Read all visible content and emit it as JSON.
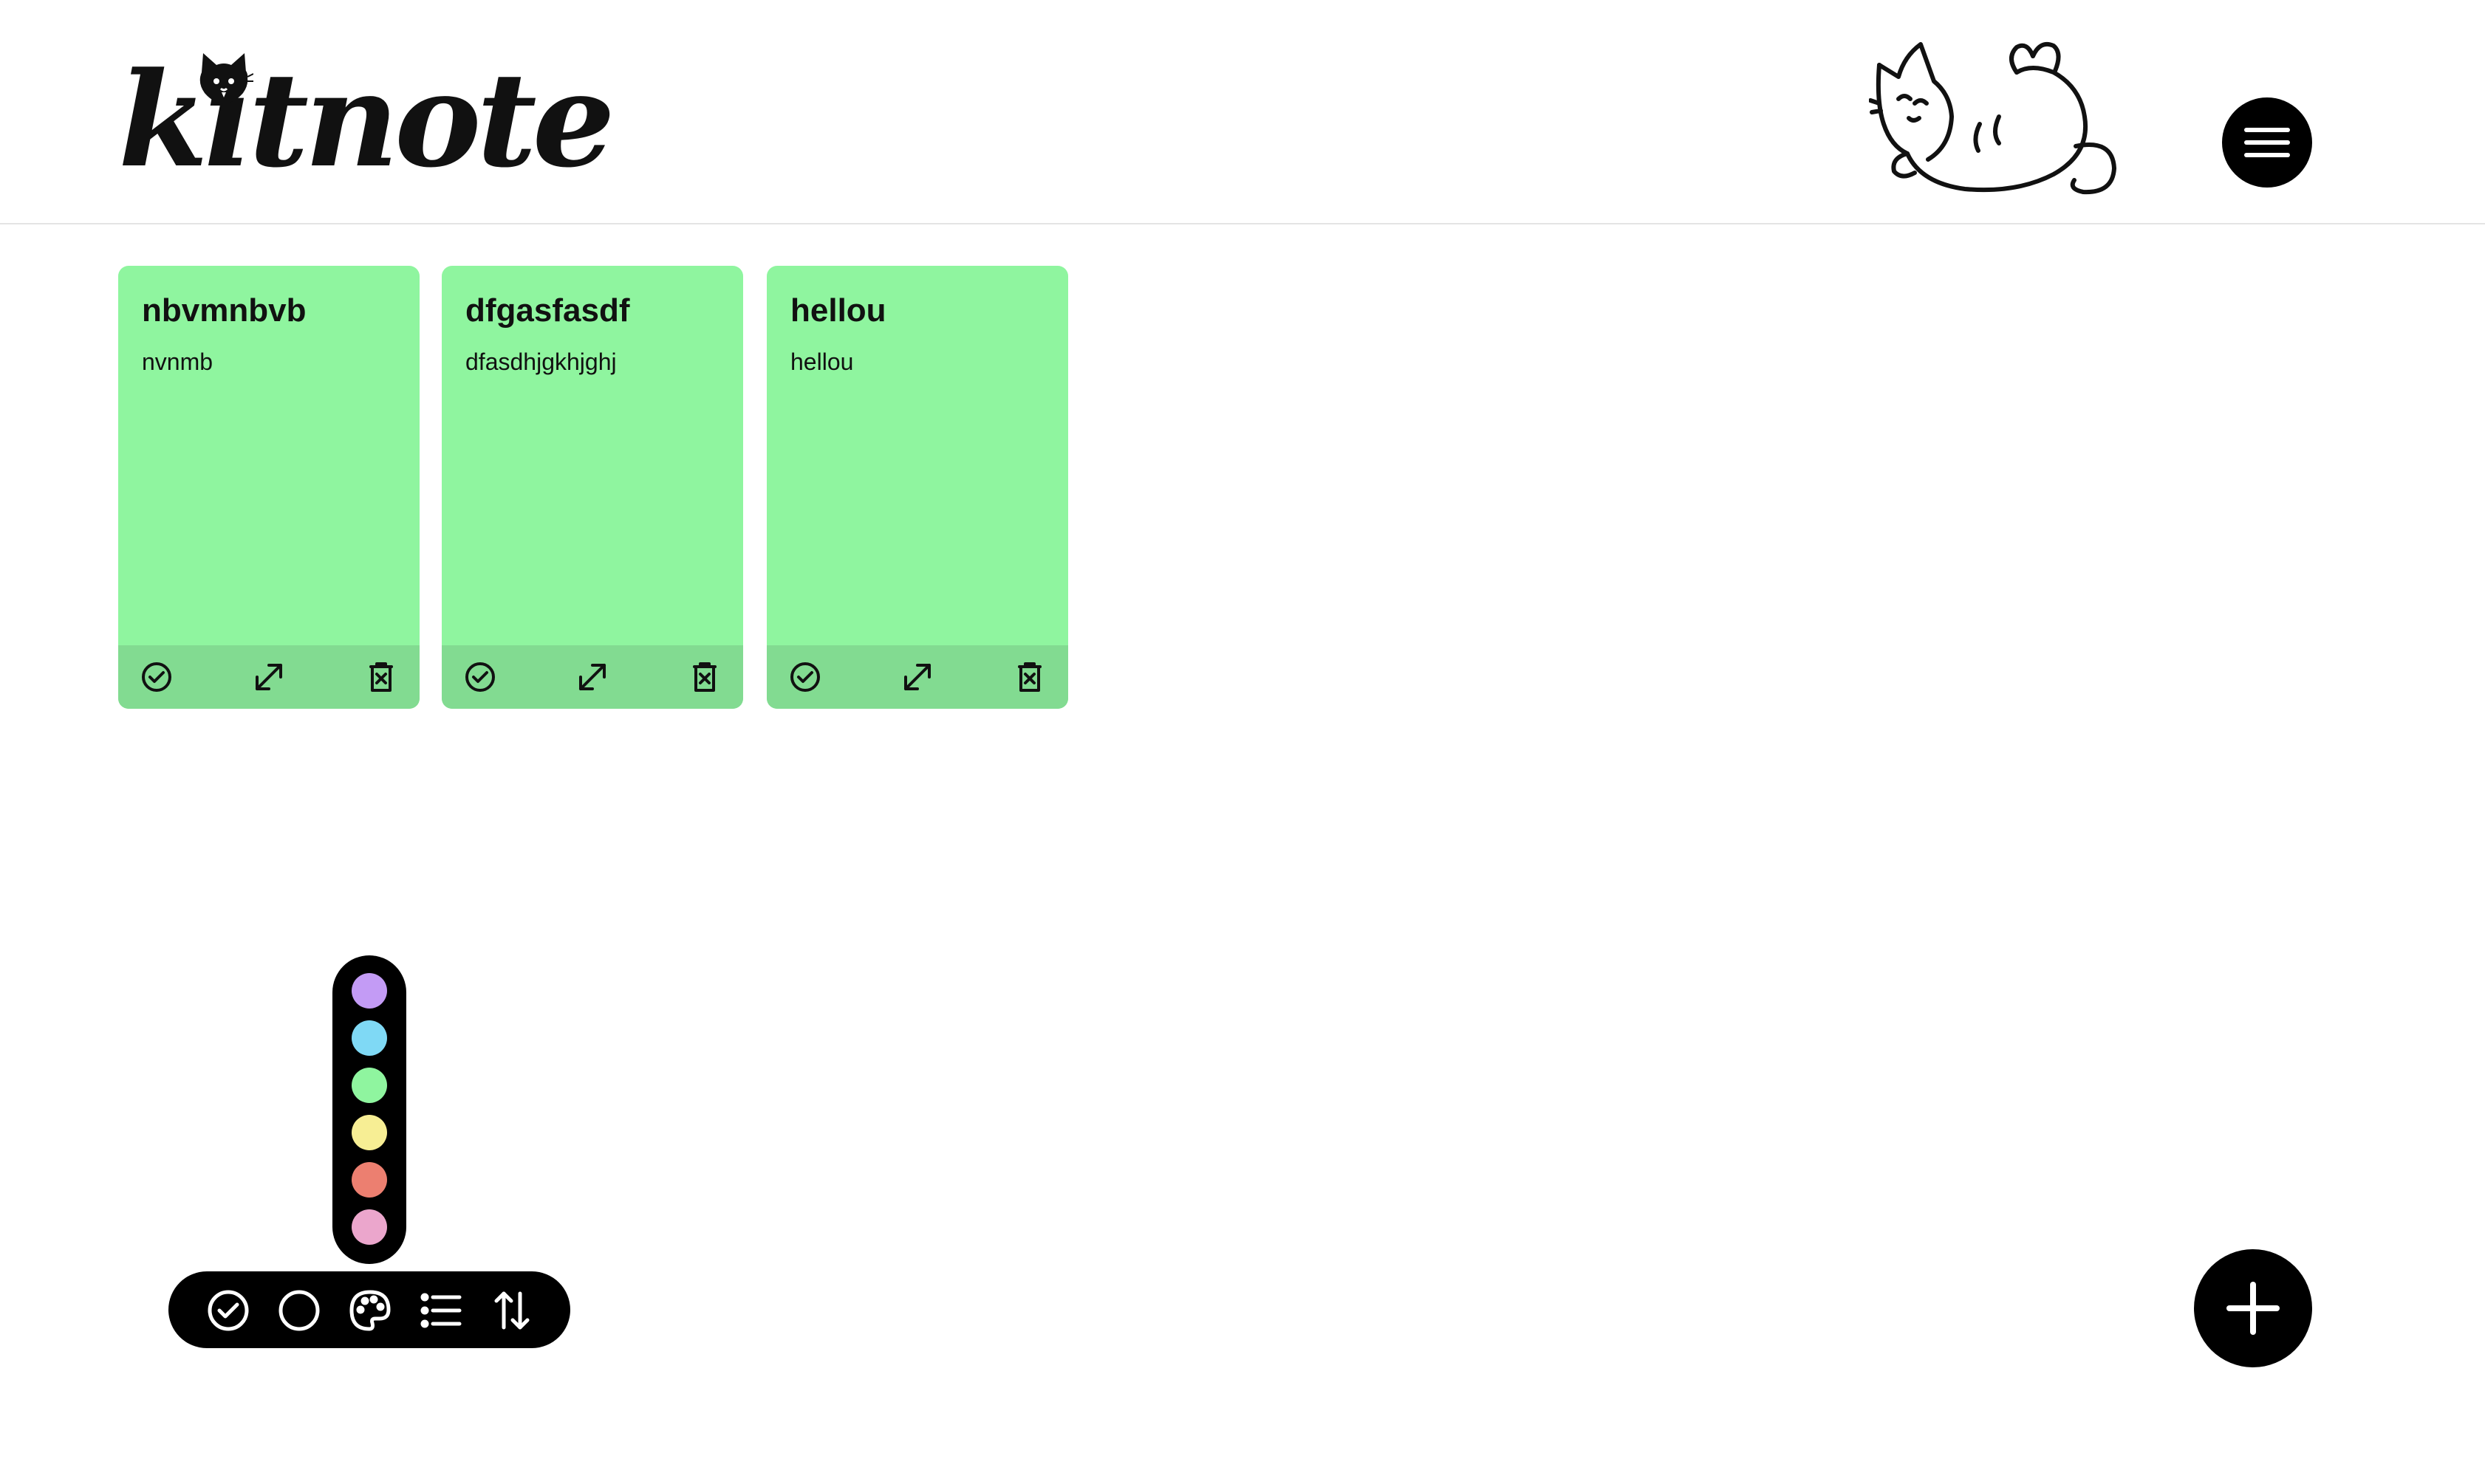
{
  "app": {
    "logo_text": "kitnote"
  },
  "header": {
    "menu_icon": "hamburger-menu-icon",
    "mascot": "sleeping-cat-illustration"
  },
  "notes": [
    {
      "title": "nbvmnbvb",
      "body": "nvnmb",
      "color": "#8ff59f"
    },
    {
      "title": "dfgasfasdf",
      "body": "dfasdhjgkhjghj",
      "color": "#8ff59f"
    },
    {
      "title": "hellou",
      "body": "hellou",
      "color": "#8ff59f"
    }
  ],
  "note_actions": [
    "check-circle-icon",
    "expand-icon",
    "delete-icon"
  ],
  "palette": {
    "colors": [
      "#c39bf5",
      "#7fd9f5",
      "#8ff59f",
      "#f7ee94",
      "#ec7f70",
      "#eba6cc"
    ]
  },
  "toolbar": {
    "icons": [
      "check-circle-icon",
      "circle-icon",
      "palette-icon",
      "list-icon",
      "sort-icon"
    ]
  },
  "fab": {
    "icon": "plus-icon"
  }
}
